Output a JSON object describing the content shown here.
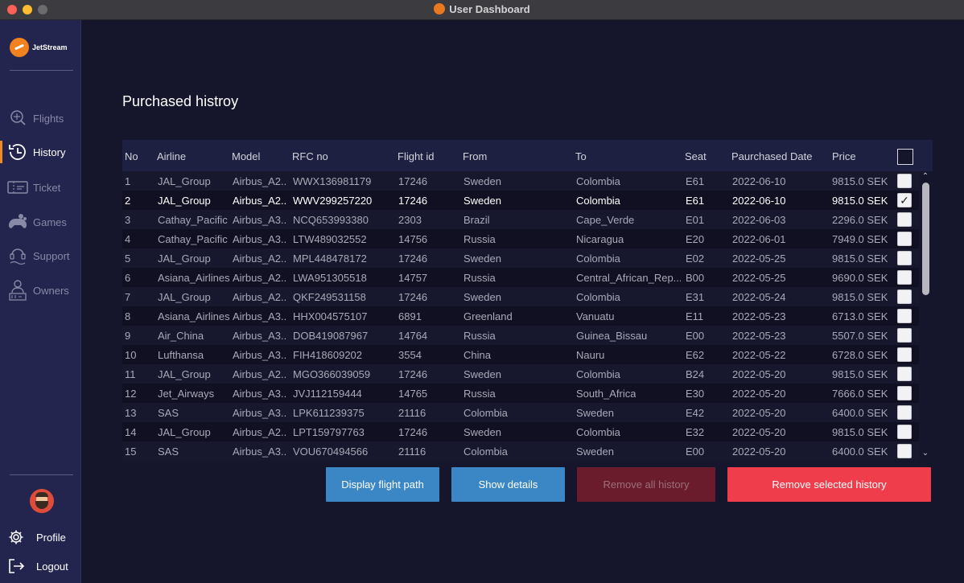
{
  "window": {
    "title": "User Dashboard"
  },
  "brand": {
    "name": "JetStream"
  },
  "sidebar": {
    "items": [
      {
        "label": "Flights",
        "icon": "flights-icon",
        "active": false
      },
      {
        "label": "History",
        "icon": "history-icon",
        "active": true
      },
      {
        "label": "Ticket",
        "icon": "ticket-icon",
        "active": false
      },
      {
        "label": "Games",
        "icon": "games-icon",
        "active": false
      },
      {
        "label": "Support",
        "icon": "support-icon",
        "active": false
      },
      {
        "label": "Owners",
        "icon": "owners-icon",
        "active": false
      }
    ],
    "footer": {
      "profile": "Profile",
      "logout": "Logout"
    }
  },
  "page": {
    "title": "Purchased histroy"
  },
  "table": {
    "headers": [
      "No",
      "Airline",
      "Model",
      "RFC no",
      "Flight id",
      "From",
      "To",
      "Seat",
      "Paurchased Date",
      "Price"
    ],
    "rows": [
      {
        "no": "1",
        "airline": "JAL_Group",
        "model": "Airbus_A2...",
        "rfc": "WWX136981179",
        "flight": "17246",
        "from": "Sweden",
        "to": "Colombia",
        "seat": "E61",
        "date": "2022-06-10",
        "price": "9815.0 SEK",
        "checked": false
      },
      {
        "no": "2",
        "airline": "JAL_Group",
        "model": "Airbus_A2...",
        "rfc": "WWV299257220",
        "flight": "17246",
        "from": "Sweden",
        "to": "Colombia",
        "seat": "E61",
        "date": "2022-06-10",
        "price": "9815.0 SEK",
        "checked": true
      },
      {
        "no": "3",
        "airline": "Cathay_Pacific",
        "model": "Airbus_A3...",
        "rfc": "NCQ653993380",
        "flight": "2303",
        "from": "Brazil",
        "to": "Cape_Verde",
        "seat": "E01",
        "date": "2022-06-03",
        "price": "2296.0 SEK",
        "checked": false
      },
      {
        "no": "4",
        "airline": "Cathay_Pacific",
        "model": "Airbus_A3...",
        "rfc": "LTW489032552",
        "flight": "14756",
        "from": "Russia",
        "to": "Nicaragua",
        "seat": "E20",
        "date": "2022-06-01",
        "price": "7949.0 SEK",
        "checked": false
      },
      {
        "no": "5",
        "airline": "JAL_Group",
        "model": "Airbus_A2...",
        "rfc": "MPL448478172",
        "flight": "17246",
        "from": "Sweden",
        "to": "Colombia",
        "seat": "E02",
        "date": "2022-05-25",
        "price": "9815.0 SEK",
        "checked": false
      },
      {
        "no": "6",
        "airline": "Asiana_Airlines",
        "model": "Airbus_A2...",
        "rfc": "LWA951305518",
        "flight": "14757",
        "from": "Russia",
        "to": "Central_African_Rep...",
        "seat": "B00",
        "date": "2022-05-25",
        "price": "9690.0 SEK",
        "checked": false
      },
      {
        "no": "7",
        "airline": "JAL_Group",
        "model": "Airbus_A2...",
        "rfc": "QKF249531158",
        "flight": "17246",
        "from": "Sweden",
        "to": "Colombia",
        "seat": "E31",
        "date": "2022-05-24",
        "price": "9815.0 SEK",
        "checked": false
      },
      {
        "no": "8",
        "airline": "Asiana_Airlines",
        "model": "Airbus_A3...",
        "rfc": "HHX004575107",
        "flight": "6891",
        "from": "Greenland",
        "to": "Vanuatu",
        "seat": "E11",
        "date": "2022-05-23",
        "price": "6713.0 SEK",
        "checked": false
      },
      {
        "no": "9",
        "airline": "Air_China",
        "model": "Airbus_A3...",
        "rfc": "DOB419087967",
        "flight": "14764",
        "from": "Russia",
        "to": "Guinea_Bissau",
        "seat": "E00",
        "date": "2022-05-23",
        "price": "5507.0 SEK",
        "checked": false
      },
      {
        "no": "10",
        "airline": "Lufthansa",
        "model": "Airbus_A3...",
        "rfc": "FIH418609202",
        "flight": "3554",
        "from": "China",
        "to": "Nauru",
        "seat": "E62",
        "date": "2022-05-22",
        "price": "6728.0 SEK",
        "checked": false
      },
      {
        "no": "11",
        "airline": "JAL_Group",
        "model": "Airbus_A2...",
        "rfc": "MGO366039059",
        "flight": "17246",
        "from": "Sweden",
        "to": "Colombia",
        "seat": "B24",
        "date": "2022-05-20",
        "price": "9815.0 SEK",
        "checked": false
      },
      {
        "no": "12",
        "airline": "Jet_Airways",
        "model": "Airbus_A3...",
        "rfc": "JVJ112159444",
        "flight": "14765",
        "from": "Russia",
        "to": "South_Africa",
        "seat": "E30",
        "date": "2022-05-20",
        "price": "7666.0 SEK",
        "checked": false
      },
      {
        "no": "13",
        "airline": "SAS",
        "model": "Airbus_A3...",
        "rfc": "LPK611239375",
        "flight": "21116",
        "from": "Colombia",
        "to": "Sweden",
        "seat": "E42",
        "date": "2022-05-20",
        "price": "6400.0 SEK",
        "checked": false
      },
      {
        "no": "14",
        "airline": "JAL_Group",
        "model": "Airbus_A2...",
        "rfc": "LPT159797763",
        "flight": "17246",
        "from": "Sweden",
        "to": "Colombia",
        "seat": "E32",
        "date": "2022-05-20",
        "price": "9815.0 SEK",
        "checked": false
      },
      {
        "no": "15",
        "airline": "SAS",
        "model": "Airbus_A3...",
        "rfc": "VOU670494566",
        "flight": "21116",
        "from": "Colombia",
        "to": "Sweden",
        "seat": "E00",
        "date": "2022-05-20",
        "price": "6400.0 SEK",
        "checked": false
      }
    ]
  },
  "actions": {
    "display_flight_path": "Display flight path",
    "show_details": "Show details",
    "remove_all": "Remove all history",
    "remove_selected": "Remove selected history"
  },
  "colors": {
    "accent": "#f08a24",
    "button_blue": "#3b87c6",
    "button_red": "#ef3d4c",
    "button_disabled": "#6b1c2c"
  }
}
